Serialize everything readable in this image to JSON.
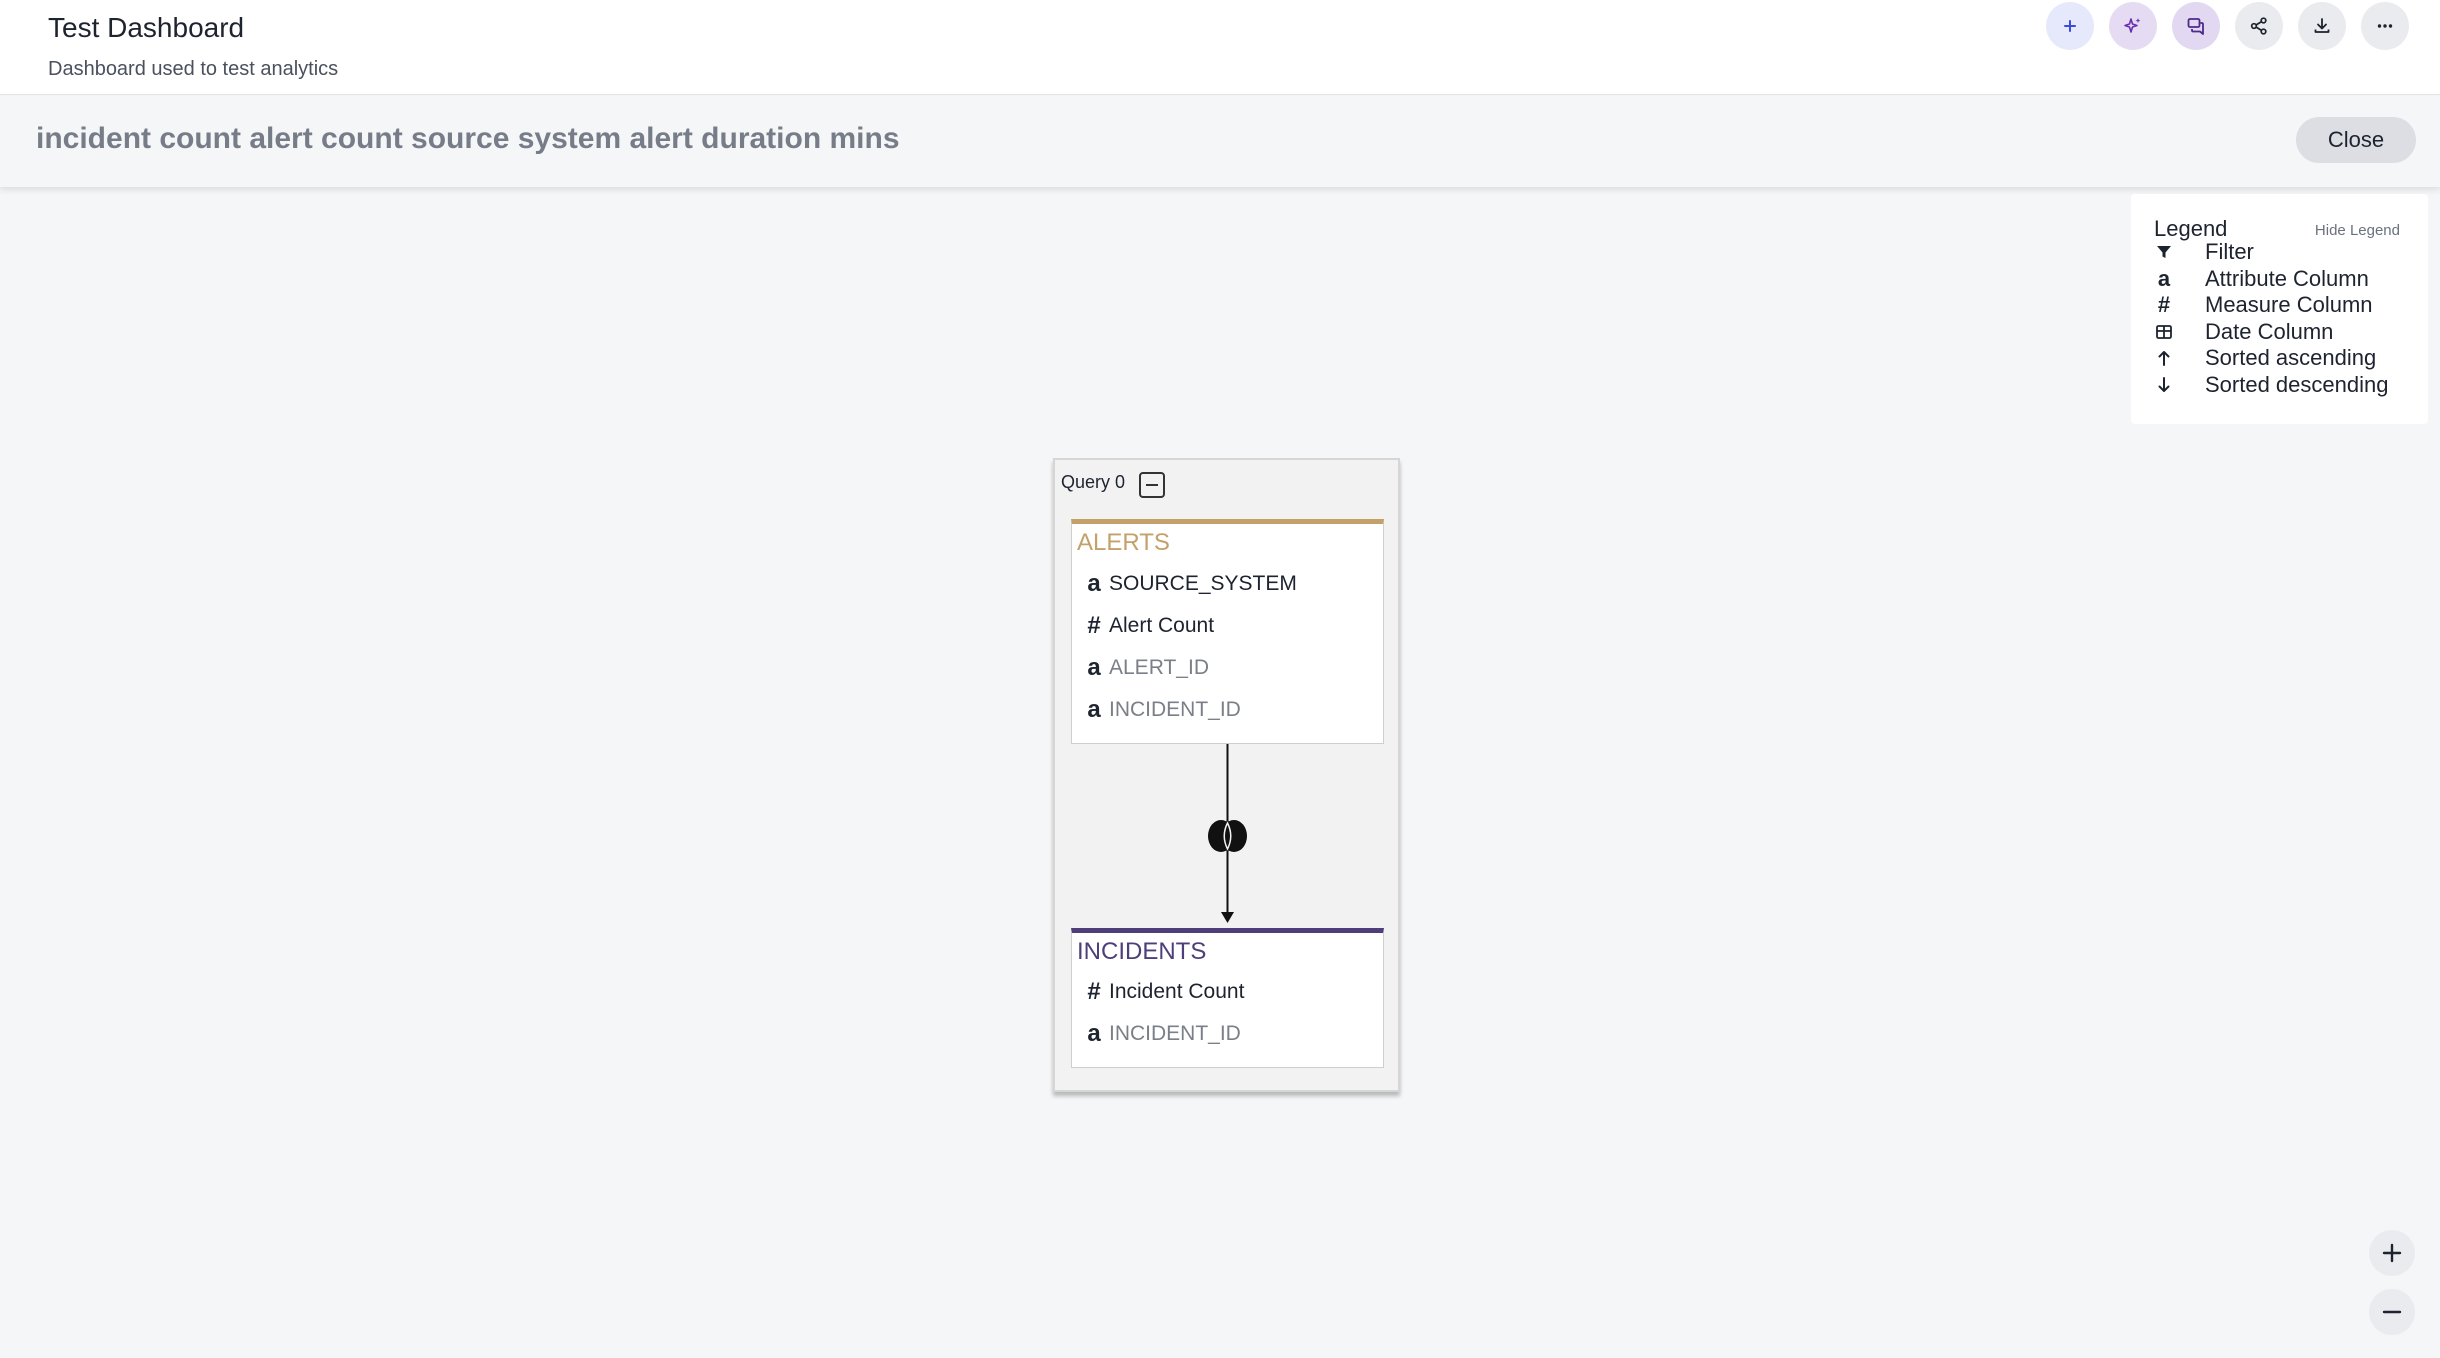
{
  "header": {
    "title": "Test Dashboard",
    "subtitle": "Dashboard used to test analytics",
    "actions": [
      "add-icon",
      "sparkle-ai-icon",
      "conversation-icon",
      "share-icon",
      "download-icon",
      "more-icon"
    ]
  },
  "query_bar": {
    "text": "incident count alert count source system alert duration mins",
    "close_label": "Close"
  },
  "legend": {
    "title": "Legend",
    "hide_label": "Hide Legend",
    "items": [
      {
        "icon": "filter-icon",
        "label": "Filter"
      },
      {
        "icon": "attribute-icon",
        "glyph": "a",
        "label": "Attribute Column"
      },
      {
        "icon": "measure-icon",
        "glyph": "#",
        "label": "Measure Column"
      },
      {
        "icon": "date-icon",
        "label": "Date Column"
      },
      {
        "icon": "arrow-up-icon",
        "label": "Sorted ascending"
      },
      {
        "icon": "arrow-down-icon",
        "label": "Sorted descending"
      }
    ]
  },
  "diagram": {
    "query_label": "Query 0",
    "tables": [
      {
        "name": "ALERTS",
        "color": "#c4a06a",
        "columns": [
          {
            "type": "attribute",
            "glyph": "a",
            "name": "SOURCE_SYSTEM",
            "dim": false
          },
          {
            "type": "measure",
            "glyph": "#",
            "name": "Alert Count",
            "dim": false
          },
          {
            "type": "attribute",
            "glyph": "a",
            "name": "ALERT_ID",
            "dim": true
          },
          {
            "type": "attribute",
            "glyph": "a",
            "name": "INCIDENT_ID",
            "dim": true
          }
        ]
      },
      {
        "name": "INCIDENTS",
        "color": "#4e3f7a",
        "columns": [
          {
            "type": "measure",
            "glyph": "#",
            "name": "Incident Count",
            "dim": false
          },
          {
            "type": "attribute",
            "glyph": "a",
            "name": "INCIDENT_ID",
            "dim": true
          }
        ]
      }
    ],
    "join_icon": "inner-join-icon"
  },
  "zoom": {
    "in_icon": "zoom-in-icon",
    "out_icon": "zoom-out-icon"
  }
}
